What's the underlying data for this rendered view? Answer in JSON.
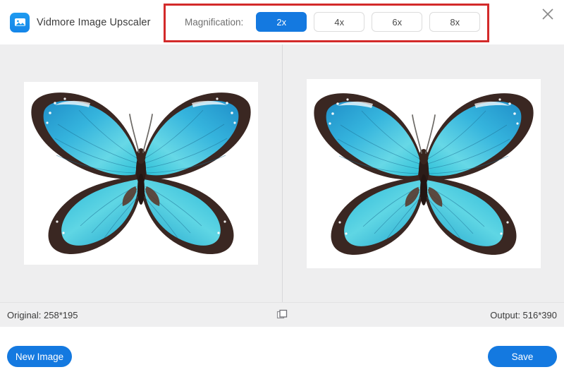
{
  "window": {
    "title": "Vidmore Image Upscaler",
    "logo_icon": "image-picture-icon",
    "close_icon": "close-x-icon",
    "accent_color": "#1479e0",
    "annotation_color": "#d32a2a",
    "background_color": "#eeeeef"
  },
  "toolbar": {
    "magnification_label": "Magnification:",
    "options": [
      {
        "label": "2x",
        "selected": true
      },
      {
        "label": "4x",
        "selected": false
      },
      {
        "label": "6x",
        "selected": false
      },
      {
        "label": "8x",
        "selected": false
      }
    ]
  },
  "preview": {
    "left_pane": {
      "name": "original-image",
      "alt": "Blue morpho butterfly on white background"
    },
    "right_pane": {
      "name": "upscaled-image",
      "alt": "Blue morpho butterfly on white background, upscaled"
    }
  },
  "statusbar": {
    "original_label": "Original: 258*195",
    "output_label": "Output: 516*390",
    "compare_icon": "compare-squares-icon"
  },
  "footer": {
    "new_image_label": "New Image",
    "save_label": "Save"
  }
}
